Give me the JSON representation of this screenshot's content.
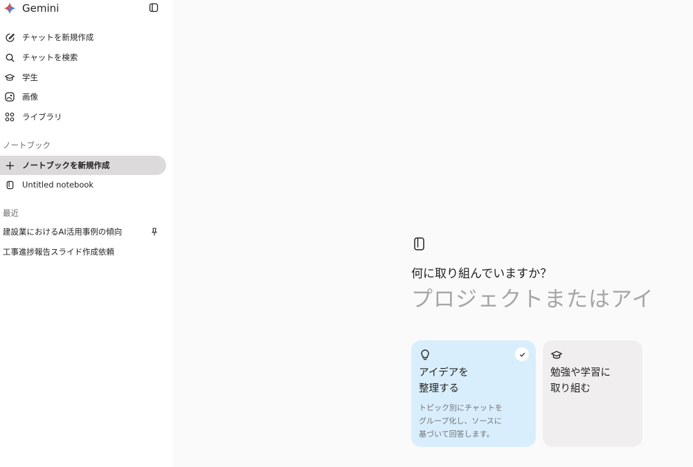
{
  "app": {
    "title": "Gemini"
  },
  "nav": [
    {
      "id": "new-chat",
      "label": "チャットを新規作成",
      "icon": "edit-pen-icon"
    },
    {
      "id": "search-chat",
      "label": "チャットを検索",
      "icon": "search-icon"
    },
    {
      "id": "student",
      "label": "学生",
      "icon": "graduation-cap-icon"
    },
    {
      "id": "images",
      "label": "画像",
      "icon": "image-icon"
    },
    {
      "id": "library",
      "label": "ライブラリ",
      "icon": "grid-icon"
    }
  ],
  "notebooks": {
    "section_label": "ノートブック",
    "new_label": "ノートブックを新規作成",
    "items": [
      {
        "label": "Untitled notebook"
      }
    ]
  },
  "recent": {
    "section_label": "最近",
    "items": [
      {
        "label": "建設業におけるAI活用事例の傾向",
        "pinned": true
      },
      {
        "label": "工事進捗報告スライド作成依頼",
        "pinned": false
      }
    ]
  },
  "main": {
    "question": "何に取り組んでいますか？",
    "input_placeholder": "プロジェクトまたはアイデアの名前",
    "cards": [
      {
        "id": "organize",
        "title": "アイデアを\n整理する",
        "description": "トピック別にチャットを\nグループ化し、ソースに\n基づいて回答します。",
        "icon": "lightbulb-icon",
        "selected": true
      },
      {
        "id": "study",
        "title": "勉強や学習に\n取り組む",
        "description": "",
        "icon": "graduation-cap-icon",
        "selected": false
      }
    ]
  },
  "colors": {
    "sidebar_bg": "#ffffff",
    "main_bg": "#fafafa",
    "active_item_bg": "#dcdadb",
    "card_selected_bg": "#d9eefc",
    "card_bg": "#f0eeee"
  }
}
